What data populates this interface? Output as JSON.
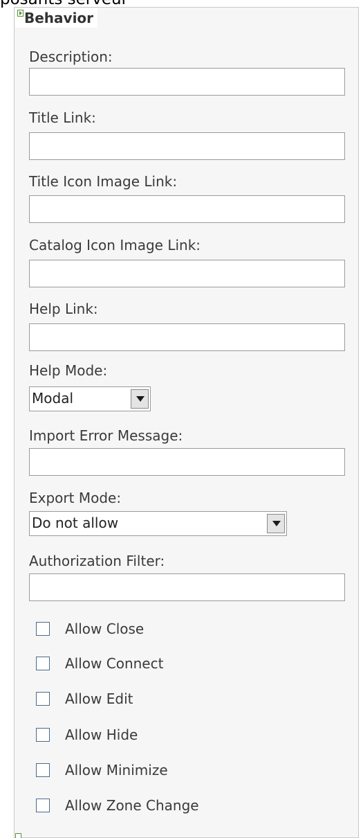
{
  "header_fragment": "posants serveur",
  "section": {
    "title": "Behavior"
  },
  "fields": {
    "description": {
      "label": "Description:",
      "value": ""
    },
    "title_link": {
      "label": "Title Link:",
      "value": ""
    },
    "title_icon_image_link": {
      "label": "Title Icon Image Link:",
      "value": ""
    },
    "catalog_icon_image_link": {
      "label": "Catalog Icon Image Link:",
      "value": ""
    },
    "help_link": {
      "label": "Help Link:",
      "value": ""
    },
    "help_mode": {
      "label": "Help Mode:",
      "selected": "Modal"
    },
    "import_error_message": {
      "label": "Import Error Message:",
      "value": ""
    },
    "export_mode": {
      "label": "Export Mode:",
      "selected": "Do not allow"
    },
    "authorization_filter": {
      "label": "Authorization Filter:",
      "value": ""
    }
  },
  "checkboxes": [
    {
      "label": "Allow Close",
      "checked": false
    },
    {
      "label": "Allow Connect",
      "checked": false
    },
    {
      "label": "Allow Edit",
      "checked": false
    },
    {
      "label": "Allow Hide",
      "checked": false
    },
    {
      "label": "Allow Minimize",
      "checked": false
    },
    {
      "label": "Allow Zone Change",
      "checked": false
    }
  ],
  "icons": {
    "section_toggle": "expand-arrow-icon",
    "dropdown": "chevron-down-icon"
  }
}
